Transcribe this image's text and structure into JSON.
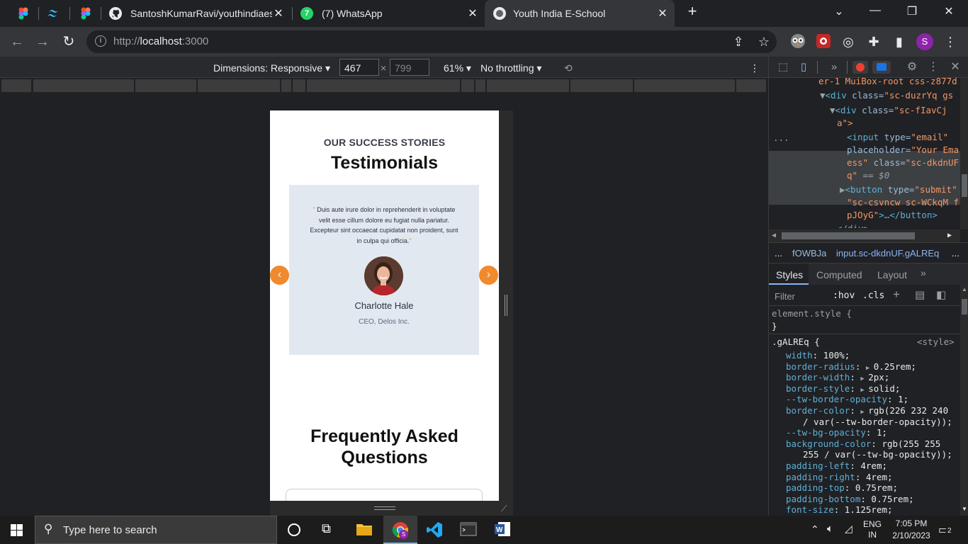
{
  "browser": {
    "tabs": [
      {
        "title": "",
        "icon": "figma-icon"
      },
      {
        "title": "",
        "icon": "tailwind-icon"
      },
      {
        "title": "",
        "icon": "figma-icon"
      },
      {
        "title": "SantoshKumarRavi/youthindiaes",
        "icon": "github-icon"
      },
      {
        "title": "(7) WhatsApp",
        "icon": "whatsapp-icon",
        "badge": "7"
      },
      {
        "title": "Youth India E-School",
        "icon": "site-icon",
        "active": true
      }
    ],
    "new_tab": "+",
    "url_host": "localhost",
    "url_prefix": "http://",
    "url_port": ":3000",
    "profile_initial": "S"
  },
  "device_toolbar": {
    "dimensions_label": "Dimensions: Responsive",
    "width": "467",
    "height": "799",
    "zoom": "61%",
    "throttle": "No throttling"
  },
  "page": {
    "eyebrow": "OUR SUCCESS STORIES",
    "testimonials_title": "Testimonials",
    "quote_open": "\"",
    "quote_text": " Duis aute irure dolor in reprehenderit in voluptate velit esse cillum dolore eu fugiat nulla pariatur. Excepteur sint occaecat cupidatat non proident, sunt in culpa qui officia.",
    "quote_close": "\"",
    "person_name": "Charlotte Hale",
    "person_role": "CEO, Delos Inc.",
    "prev_arrow": "‹",
    "next_arrow": "›",
    "faq_title_line1": "Frequently Asked",
    "faq_title_line2": "Questions",
    "accent_color": "#f08a2c",
    "card_color": "#e2e8f0"
  },
  "devtools": {
    "elements": {
      "line1": "er-1 MuiBox-root css-z877d",
      "line2_tag": "<div ",
      "line2_attr": "class=",
      "line2_val": "\"sc-duzrYq gs",
      "line3_tag": "<div ",
      "line3_attr": "class=",
      "line3_val": "\"sc-fIavCj ",
      "line4_val": "a\">",
      "line5_tag": "<input ",
      "line5_attr": "type=",
      "line5_val": "\"email\"",
      "line6_attr": "placeholder=",
      "line6_val": "\"Your Ema",
      "line7_val": "ess\"",
      "line7_attr": " class=",
      "line7_val2": "\"sc-dkdnUF",
      "line8_val": "q\"",
      "line8_eq": "== $0",
      "line9_tag": "<button ",
      "line9_attr": "type=",
      "line9_val": "\"submit\"",
      "line10_val": "\"sc-csvncw sc-WCkqM f",
      "line11_val": "pJOyG\"",
      "line11_rest": ">…</button>",
      "line12": "</div>",
      "dots": "..."
    },
    "breadcrumb": {
      "dots": "...",
      "item1": "fOWBJa",
      "item2": "input.sc-dkdnUF.gALREq",
      "more": "..."
    },
    "tabs": {
      "styles": "Styles",
      "computed": "Computed",
      "layout": "Layout",
      "more": "»"
    },
    "filter": {
      "placeholder": "Filter",
      "hov": ":hov",
      "cls": ".cls",
      "plus": "+"
    },
    "styles": {
      "element_style": "element.style {",
      "close1": "}",
      "selector": ".gALREq {",
      "source": "<style>",
      "rules": [
        {
          "prop": "width",
          "val": "100%;"
        },
        {
          "prop": "border-radius",
          "val": "0.25rem;",
          "arrow": true
        },
        {
          "prop": "border-width",
          "val": "2px;",
          "arrow": true
        },
        {
          "prop": "border-style",
          "val": "solid;",
          "arrow": true
        },
        {
          "prop": "--tw-border-opacity",
          "val": "1;"
        },
        {
          "prop": "border-color",
          "val": "rgb(226 232 240",
          "arrow": true
        },
        {
          "prop": "",
          "val": "/ var(--tw-border-opacity));",
          "indent": true
        },
        {
          "prop": "--tw-bg-opacity",
          "val": "1;"
        },
        {
          "prop": "background-color",
          "val": "rgb(255 255"
        },
        {
          "prop": "",
          "val": "255 / var(--tw-bg-opacity));",
          "indent": true
        },
        {
          "prop": "padding-left",
          "val": "4rem;"
        },
        {
          "prop": "padding-right",
          "val": "4rem;"
        },
        {
          "prop": "padding-top",
          "val": "0.75rem;"
        },
        {
          "prop": "padding-bottom",
          "val": "0.75rem;"
        },
        {
          "prop": "font-size",
          "val": "1.125rem;"
        }
      ]
    }
  },
  "taskbar": {
    "search_placeholder": "Type here to search",
    "lang1": "ENG",
    "lang2": "IN",
    "time": "7:05 PM",
    "date": "2/10/2023",
    "notif_count": "2"
  }
}
